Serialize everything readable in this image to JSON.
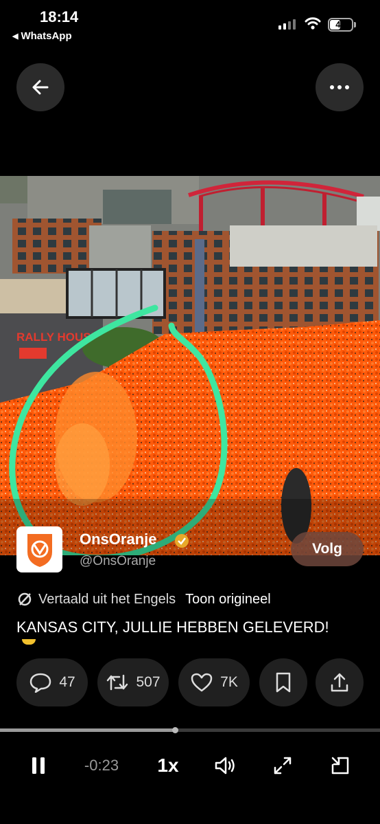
{
  "status_bar": {
    "time": "18:14",
    "back_app": "WhatsApp",
    "battery": "41"
  },
  "video": {
    "storefront_sign": "RALLY HOUSE",
    "annotation_color": "#3ee6a0",
    "crowd_color": "#ff5a0a"
  },
  "account": {
    "name": "OnsOranje",
    "handle": "@OnsOranje",
    "follow_label": "Volg"
  },
  "translation": {
    "label": "Vertaald uit het Engels",
    "show_original": "Toon origineel"
  },
  "tweet_text": "KANSAS CITY, JULLIE HEBBEN GELEVERD!",
  "actions": {
    "replies": "47",
    "reposts": "507",
    "likes": "7K"
  },
  "player": {
    "remaining": "-0:23",
    "speed": "1x",
    "progress": 0.46
  }
}
